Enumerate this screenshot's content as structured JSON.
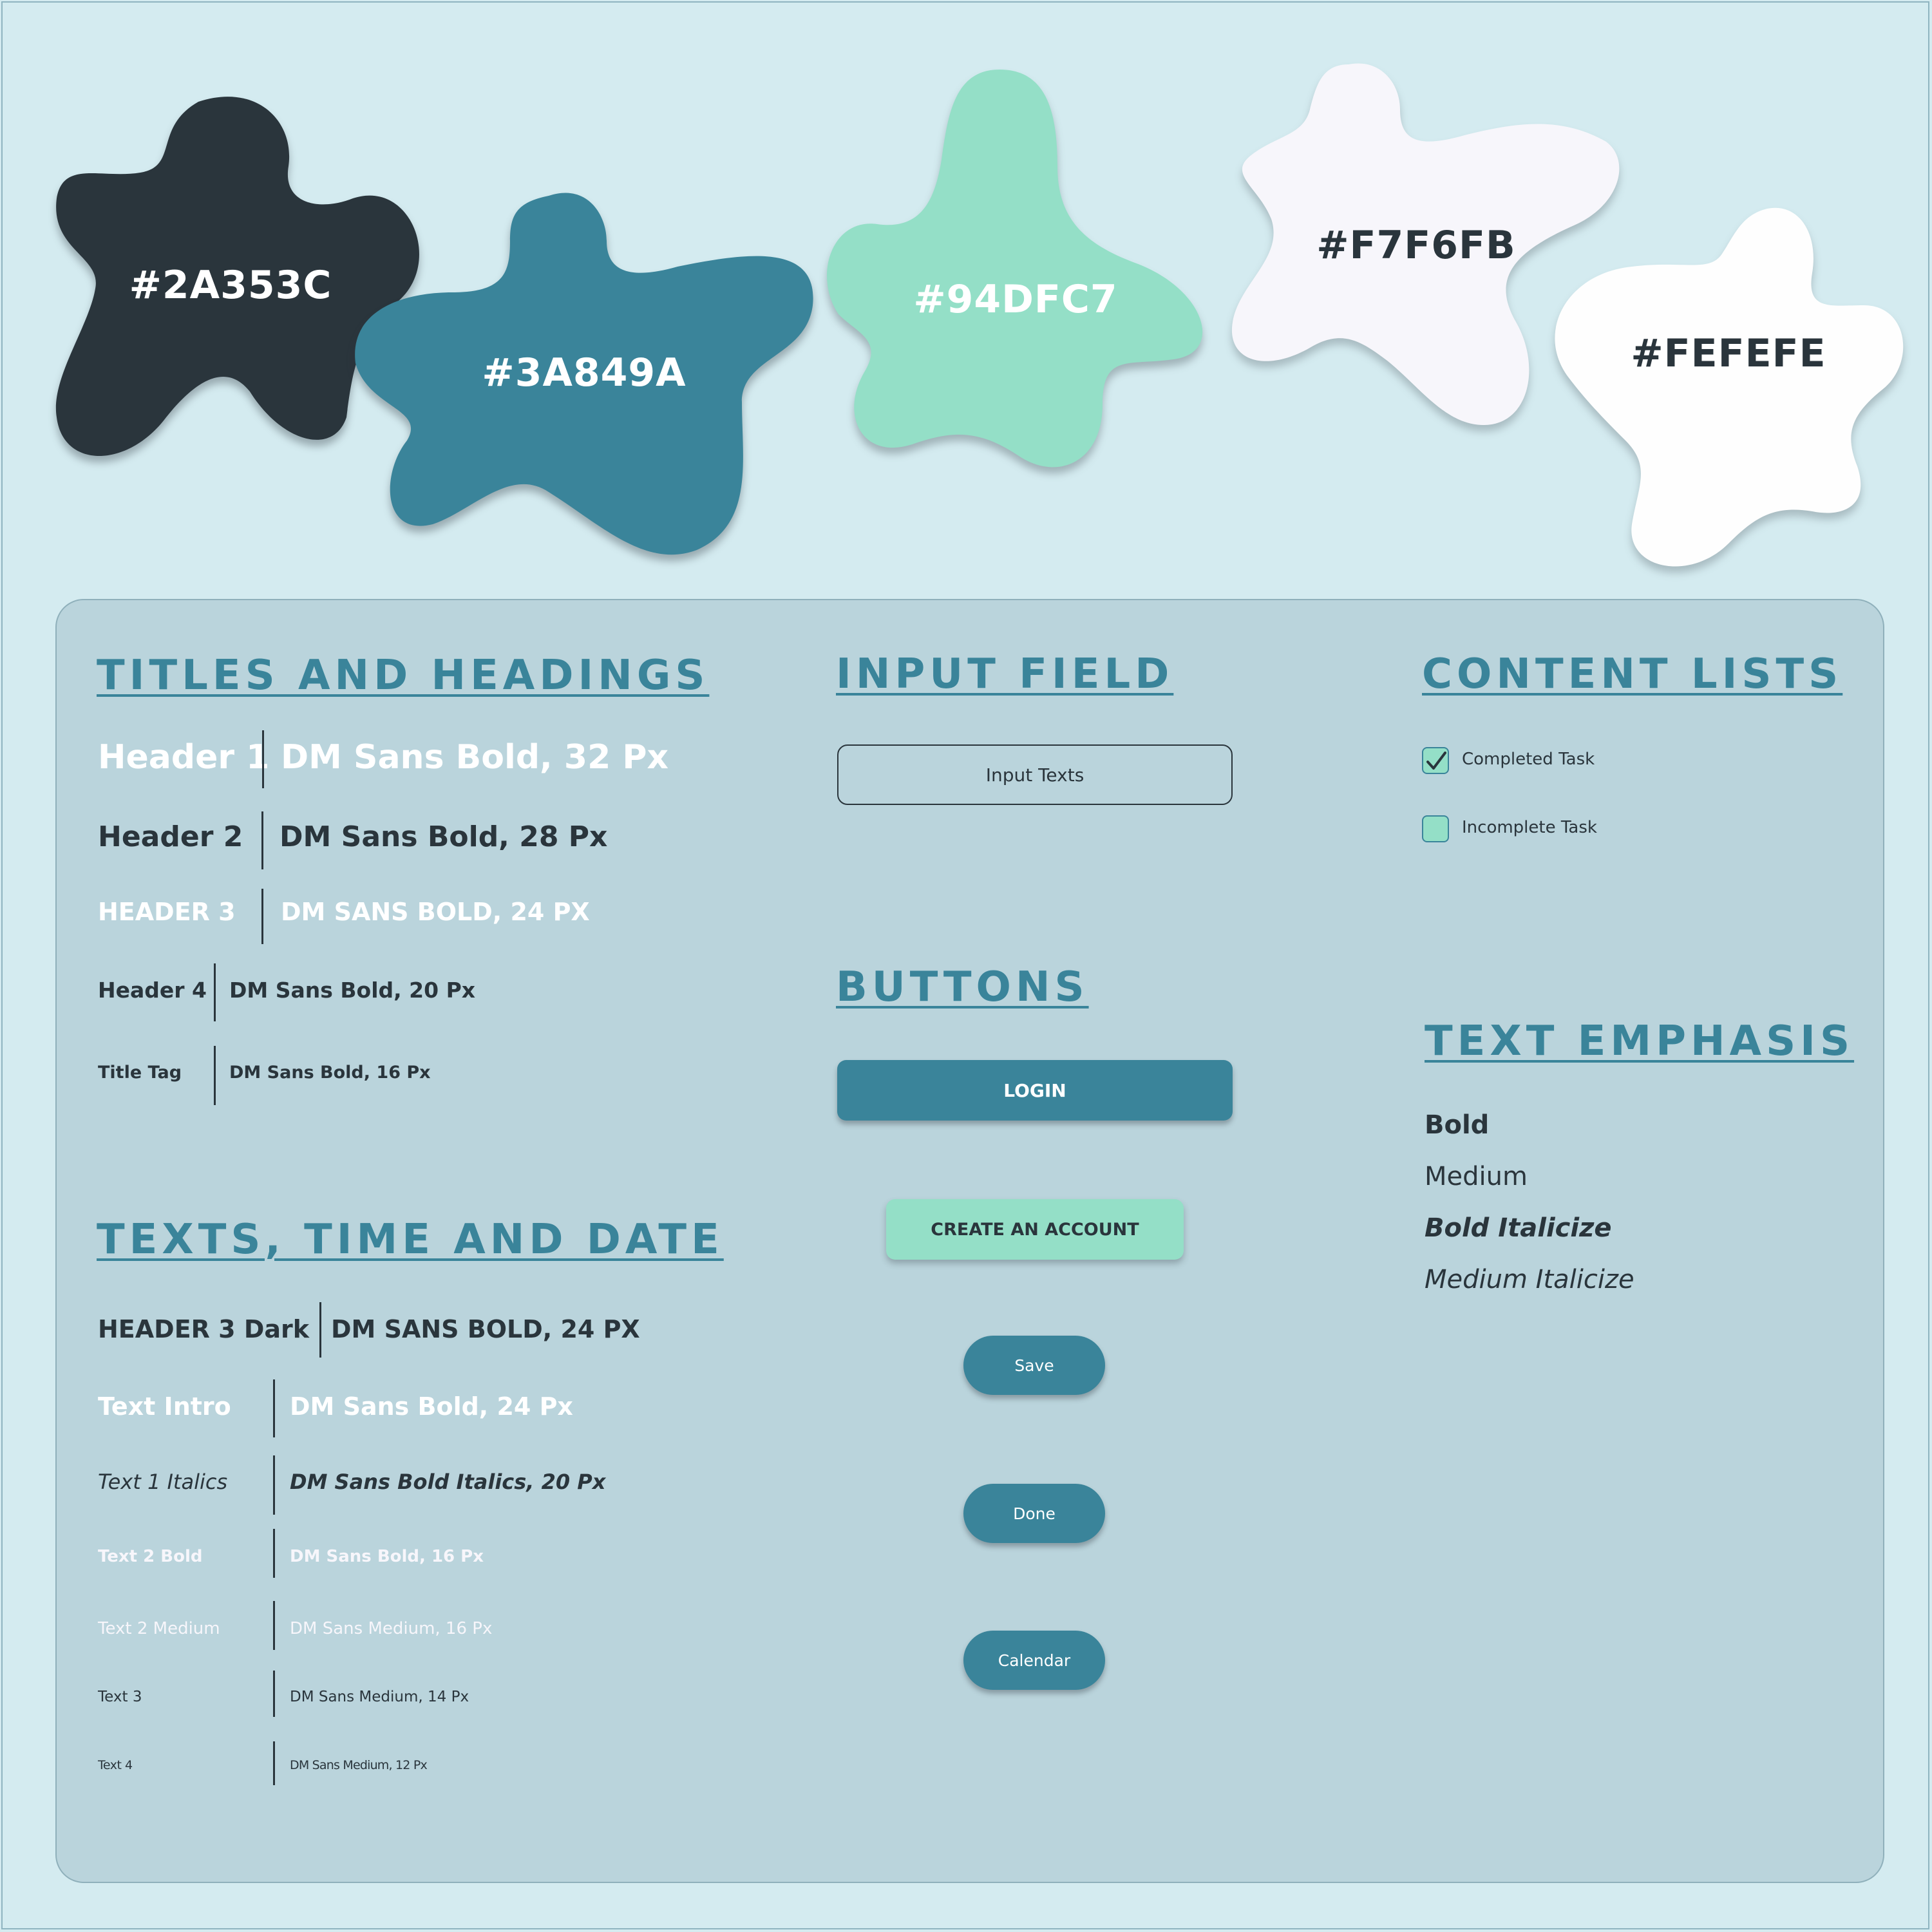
{
  "colors": {
    "dark": "#2A353C",
    "teal": "#3A849A",
    "mint": "#94DFC7",
    "offwhite": "#F7F6FB",
    "white": "#FEFEFE",
    "page_bg": "#D4EBF0",
    "panel_bg": "#BAD4DC"
  },
  "swatches": [
    {
      "label": "#2A353C",
      "fill": "#2A353C",
      "text_color": "#FFFFFF"
    },
    {
      "label": "#3A849A",
      "fill": "#3A849A",
      "text_color": "#FFFFFF"
    },
    {
      "label": "#94DFC7",
      "fill": "#94DFC7",
      "text_color": "#FFFFFF"
    },
    {
      "label": "#F7F6FB",
      "fill": "#F7F6FB",
      "text_color": "#2A353C"
    },
    {
      "label": "#FEFEFE",
      "fill": "#FEFEFE",
      "text_color": "#2A353C"
    }
  ],
  "titles_section": {
    "title": "TITLES AND HEADINGS",
    "rows": [
      {
        "name": "Header 1",
        "spec": "DM Sans Bold, 32 Px"
      },
      {
        "name": "Header 2",
        "spec": "DM Sans Bold, 28 Px"
      },
      {
        "name": "HEADER 3",
        "spec": "DM SANS BOLD, 24 PX"
      },
      {
        "name": "Header 4",
        "spec": "DM Sans Bold, 20 Px"
      },
      {
        "name": "Title Tag",
        "spec": "DM Sans Bold, 16 Px"
      }
    ]
  },
  "texts_section": {
    "title": "TEXTS, TIME AND DATE",
    "rows": [
      {
        "name": "HEADER 3 Dark",
        "spec": "DM SANS BOLD, 24 PX"
      },
      {
        "name": "Text Intro",
        "spec": "DM Sans Bold, 24 Px"
      },
      {
        "name": "Text 1 Italics",
        "spec": "DM Sans Bold Italics, 20 Px"
      },
      {
        "name": "Text 2 Bold",
        "spec": "DM Sans Bold, 16 Px"
      },
      {
        "name": "Text 2 Medium",
        "spec": "DM Sans Medium, 16 Px"
      },
      {
        "name": "Text 3",
        "spec": "DM Sans Medium, 14 Px"
      },
      {
        "name": "Text 4",
        "spec": "DM Sans Medium, 12 Px"
      }
    ]
  },
  "input_section": {
    "title": "INPUT FIELD",
    "input_value": "Input Texts"
  },
  "buttons_section": {
    "title": "BUTTONS",
    "login": "LOGIN",
    "create_account": "CREATE AN ACCOUNT",
    "save": "Save",
    "done": "Done",
    "calendar": "Calendar"
  },
  "lists_section": {
    "title": "CONTENT LISTS",
    "items": [
      {
        "label": "Completed Task",
        "checked": true
      },
      {
        "label": "Incomplete Task",
        "checked": false
      }
    ]
  },
  "emphasis_section": {
    "title": "TEXT EMPHASIS",
    "items": [
      "Bold",
      "Medium",
      "Bold Italicize",
      "Medium Italicize"
    ]
  }
}
